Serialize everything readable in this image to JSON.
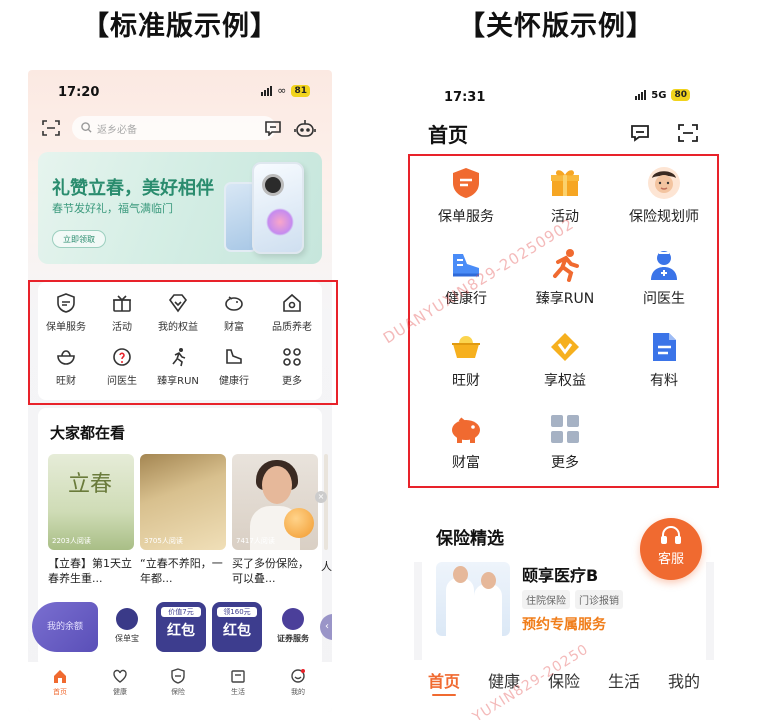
{
  "captions": {
    "standard": "【标准版示例】",
    "care": "【关怀版示例】"
  },
  "left": {
    "status": {
      "time": "17:20",
      "battery": "81"
    },
    "search": {
      "placeholder": "返乡必备"
    },
    "banner": {
      "title": "礼赞立春，美好相伴",
      "subtitle": "春节发好礼，福气满临门",
      "button": "立即领取"
    },
    "grid": [
      {
        "label": "保单服务",
        "icon": "policy-shield-icon"
      },
      {
        "label": "活动",
        "icon": "gift-box-icon"
      },
      {
        "label": "我的权益",
        "icon": "diamond-heart-icon"
      },
      {
        "label": "财富",
        "icon": "piggy-bank-icon"
      },
      {
        "label": "品质养老",
        "icon": "house-icon"
      },
      {
        "label": "旺财",
        "icon": "ingot-bowl-icon"
      },
      {
        "label": "问医生",
        "icon": "question-badge-icon"
      },
      {
        "label": "臻享RUN",
        "icon": "runner-icon"
      },
      {
        "label": "健康行",
        "icon": "shoe-icon"
      },
      {
        "label": "更多",
        "icon": "four-dots-icon"
      }
    ],
    "feed": {
      "heading": "大家都在看",
      "cards": [
        {
          "img_text": "立春",
          "reads": "2203人阅读",
          "title": "【立春】第1天立春养生重..."
        },
        {
          "reads": "3705人阅读",
          "title": "“立春不养阳，一年都..."
        },
        {
          "reads": "7417人阅读",
          "title": "买了多份保险，可以叠..."
        }
      ],
      "partial_card_title": "人"
    },
    "promo": {
      "balance": "我的余额",
      "bao": "保单宝",
      "redpacket1_tag": "价值7元",
      "redpacket1": "红包",
      "redpacket2_tag": "领160元",
      "redpacket2": "红包",
      "securities": "证券服务"
    },
    "tabs": [
      {
        "label": "首页",
        "icon": "home-icon"
      },
      {
        "label": "健康",
        "icon": "heart-icon"
      },
      {
        "label": "保险",
        "icon": "shield-icon"
      },
      {
        "label": "生活",
        "icon": "bag-icon"
      },
      {
        "label": "我的",
        "icon": "smile-face-icon"
      }
    ]
  },
  "right": {
    "status": {
      "time": "17:31",
      "network": "5G",
      "battery": "80"
    },
    "title": "首页",
    "grid": [
      {
        "label": "保单服务",
        "icon": "policy-shield-icon"
      },
      {
        "label": "活动",
        "icon": "gift-box-icon"
      },
      {
        "label": "保险规划师",
        "icon": "advisor-avatar-icon"
      },
      {
        "label": "健康行",
        "icon": "shoe-icon"
      },
      {
        "label": "臻享RUN",
        "icon": "runner-icon"
      },
      {
        "label": "问医生",
        "icon": "doctor-icon"
      },
      {
        "label": "旺财",
        "icon": "ingot-icon"
      },
      {
        "label": "享权益",
        "icon": "diamond-v-icon"
      },
      {
        "label": "有料",
        "icon": "document-icon"
      },
      {
        "label": "财富",
        "icon": "piggy-bank-icon"
      },
      {
        "label": "更多",
        "icon": "four-squares-icon"
      }
    ],
    "selection": {
      "heading": "保险精选",
      "product": "颐享医疗B",
      "tags": [
        "住院保险",
        "门诊报销"
      ],
      "cta": "预约专属服务"
    },
    "service_button": "客服",
    "tabs": [
      "首页",
      "健康",
      "保险",
      "生活",
      "我的"
    ]
  },
  "watermarks": [
    "DUANYUXIN829-20250902",
    "YUXIN829-20250"
  ],
  "colors": {
    "accent": "#f06a30",
    "highlight": "#e8222a",
    "banner_green": "#2a8c6e",
    "promo_indigo": "#3d3d8e"
  }
}
